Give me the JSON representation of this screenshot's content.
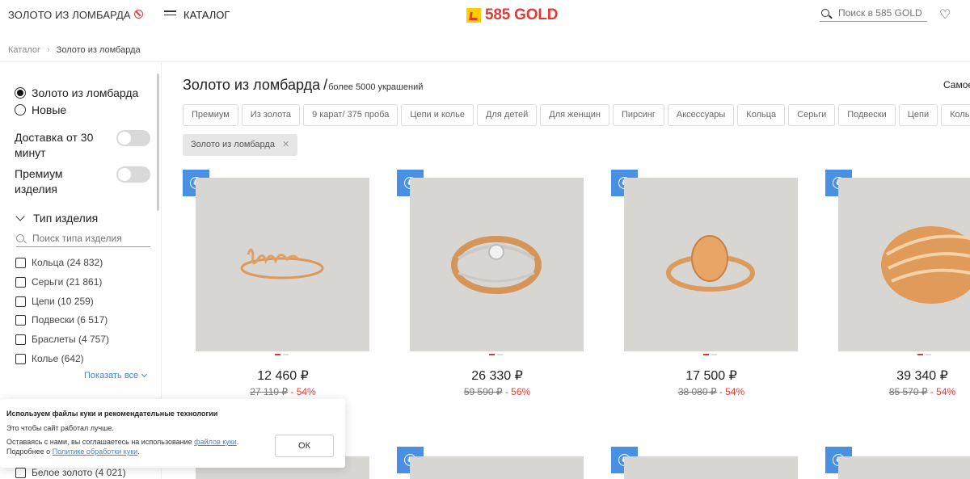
{
  "header": {
    "pawn_link": "ЗОЛОТО ИЗ ЛОМБАРДА",
    "catalog": "КАТАЛОГ",
    "logo": "585 GOLD",
    "search_placeholder": "Поиск в 585 GOLD"
  },
  "breadcrumb": {
    "root": "Каталог",
    "current": "Золото из ломбарда"
  },
  "sidebar": {
    "radios": [
      {
        "label": "Золото из ломбарда",
        "checked": true
      },
      {
        "label": "Новые",
        "checked": false
      }
    ],
    "toggles": [
      {
        "label": "Доставка от 30 минут",
        "on": false
      },
      {
        "label": "Премиум изделия",
        "on": false
      }
    ],
    "type_section": "Тип изделия",
    "type_search_placeholder": "Поиск типа изделия",
    "types": [
      "Кольца (24 832)",
      "Серьги (21 861)",
      "Цепи (10 259)",
      "Подвески (6 517)",
      "Браслеты (4 757)",
      "Колье (642)"
    ],
    "show_all": "Показать все",
    "partial_item": "Белое золото (4 021)"
  },
  "main": {
    "title": "Золото из ломбарда",
    "slash": "/",
    "count": "более 5000 украшений",
    "sort": "Самое",
    "chips": [
      "Премиум",
      "Из золота",
      "9 карат/ 375 проба",
      "Цепи и колье",
      "Для детей",
      "Для женщин",
      "Пирсинг",
      "Аксессуары",
      "Кольца",
      "Серьги",
      "Подвески",
      "Цепи",
      "Кольцо"
    ],
    "active_chip": "Золото из ломбарда"
  },
  "products": [
    {
      "price": "12 460 ₽",
      "old_price": "27 110 ₽",
      "sep": " - ",
      "discount": "54%"
    },
    {
      "price": "26 330 ₽",
      "old_price": "59 590 ₽",
      "sep": " - ",
      "discount": "56%"
    },
    {
      "price": "17 500 ₽",
      "old_price": "38 080 ₽",
      "sep": " - ",
      "discount": "54%"
    },
    {
      "price": "39 340 ₽",
      "old_price": "85 570 ₽",
      "sep": " - ",
      "discount": "54%"
    }
  ],
  "cookie": {
    "title": "Используем файлы куки и рекомендательные технологии",
    "line1": "Это чтобы сайт работал лучше.",
    "line2_pre": "Оставаясь с нами, вы соглашаетесь на использование ",
    "line2_link": "файлов куки",
    "line2_post": ".",
    "line3_pre": "Подробнее о ",
    "line3_link": "Политике обработки куки",
    "line3_post": ".",
    "ok": "ОК"
  },
  "colors": {
    "brand": "#e53935",
    "brand_yellow": "#ffcc00",
    "badge": "#4a90e2",
    "link": "#4a7fd4"
  }
}
